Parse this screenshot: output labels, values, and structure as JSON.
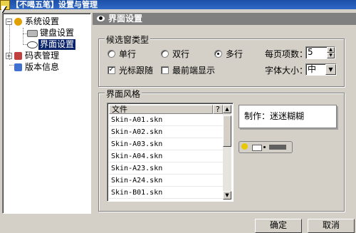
{
  "window": {
    "title": "【不喝五笔】设置与管理"
  },
  "tree": {
    "items": [
      {
        "label": "系统设置",
        "expander": "−",
        "icon": "gear-icon"
      },
      {
        "label": "键盘设置",
        "icon": "keyboard-icon"
      },
      {
        "label": "界面设置",
        "icon": "eye-icon",
        "selected": true
      },
      {
        "label": "码表管理",
        "expander": "+",
        "icon": "table-icon"
      },
      {
        "label": "版本信息",
        "icon": "info-icon"
      }
    ]
  },
  "panel": {
    "title": "界面设置"
  },
  "candidate_type": {
    "title": "候选窗类型",
    "options": [
      {
        "label": "单行",
        "checked": false
      },
      {
        "label": "双行",
        "checked": false
      },
      {
        "label": "多行",
        "checked": true
      }
    ],
    "cursor_follow": {
      "label": "光标跟随",
      "checked": true,
      "mark": "✓"
    },
    "always_on_top": {
      "label": "最前端显示",
      "checked": false,
      "mark": ""
    },
    "page_size": {
      "label": "每页项数：",
      "value": "5"
    },
    "font_size": {
      "label": "字体大小：",
      "value": "中"
    }
  },
  "style": {
    "title": "界面风格",
    "columns": {
      "file": "文件",
      "q": "?"
    },
    "skins": [
      "Skin-A01.skn",
      "Skin-A02.skn",
      "Skin-A03.skn",
      "Skin-A04.skn",
      "Skin-A23.skn",
      "Skin-A24.skn",
      "Skin-B01.skn"
    ],
    "preview_text": "制作：迷迷糊糊"
  },
  "footer": {
    "ok": "确定",
    "cancel": "取消"
  },
  "colors": {
    "title_bar": "#2a5fba",
    "selection": "#0a246a",
    "header": "#808080"
  }
}
